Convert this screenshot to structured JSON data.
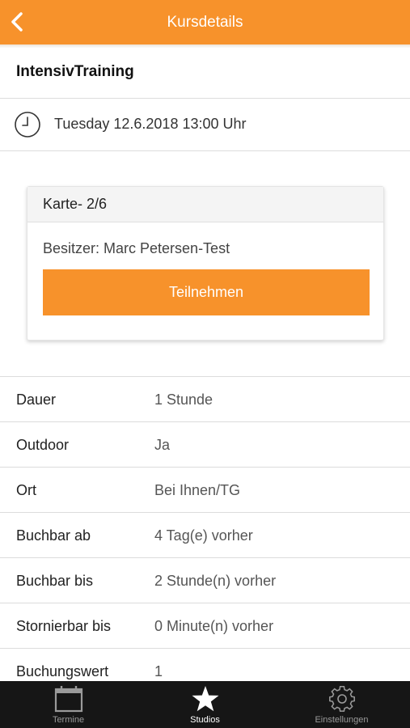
{
  "header": {
    "title": "Kursdetails",
    "back_icon": "chevron-left-icon",
    "background": "#f7922b"
  },
  "course": {
    "name": "IntensivTraining",
    "datetime": "Tuesday 12.6.2018 13:00 Uhr"
  },
  "card": {
    "title": "Karte- 2/6",
    "owner": "Besitzer: Marc Petersen-Test",
    "join_label": "Teilnehmen",
    "accent": "#f7922b"
  },
  "details": [
    {
      "label": "Dauer",
      "value": "1 Stunde"
    },
    {
      "label": "Outdoor",
      "value": "Ja"
    },
    {
      "label": "Ort",
      "value": "Bei Ihnen/TG"
    },
    {
      "label": "Buchbar ab",
      "value": "4 Tag(e) vorher"
    },
    {
      "label": "Buchbar bis",
      "value": "2 Stunde(n) vorher"
    },
    {
      "label": "Stornierbar bis",
      "value": "0 Minute(n) vorher"
    },
    {
      "label": "Buchungswert",
      "value": "1"
    }
  ],
  "tabbar": {
    "tabs": [
      {
        "label": "Termine",
        "icon": "calendar-icon",
        "active": false
      },
      {
        "label": "Studios",
        "icon": "star-icon",
        "active": true
      },
      {
        "label": "Einstellungen",
        "icon": "gear-icon",
        "active": false
      }
    ]
  }
}
